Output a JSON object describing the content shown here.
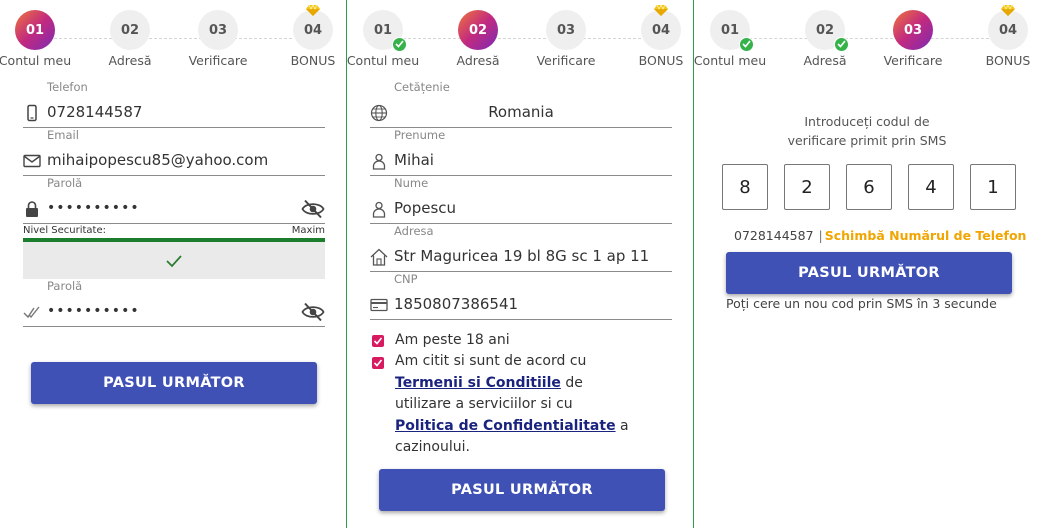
{
  "steps": [
    {
      "num": "01",
      "label": "Contul meu"
    },
    {
      "num": "02",
      "label": "Adresă"
    },
    {
      "num": "03",
      "label": "Verificare"
    },
    {
      "num": "04",
      "label": "BONUS"
    }
  ],
  "colors": {
    "accent": "#3f51b5",
    "success": "#36b24a",
    "checkbox": "#d81b60",
    "link": "#1a237e",
    "highlight": "#f0a500",
    "divider": "#2e9a4a"
  },
  "account": {
    "phone_label": "Telefon",
    "phone_value": "0728144587",
    "email_label": "Email",
    "email_value": "mihaipopescu85@yahoo.com",
    "password_label": "Parolă",
    "password_value": "••••••••••",
    "security_label": "Nivel Securitate:",
    "security_level": "Maxim",
    "security_fraction": 1.0,
    "confirm_label": "Parolă",
    "confirm_value": "••••••••••",
    "next_button": "PASUL URMĂTOR"
  },
  "address": {
    "citizenship_label": "Cetățenie",
    "citizenship_value": "Romania",
    "firstname_label": "Prenume",
    "firstname_value": "Mihai",
    "lastname_label": "Nume",
    "lastname_value": "Popescu",
    "address_label": "Adresa",
    "address_value": "Str Maguricea 19 bl 8G sc 1 ap 11",
    "cnp_label": "CNP",
    "cnp_value": "1850807386541",
    "age_check": "Am peste 18 ani",
    "terms_pre": "Am citit si sunt de acord cu",
    "terms_link": "Termenii si Conditiile",
    "terms_mid": "de utilizare a serviciilor si cu",
    "privacy_link": "Politica de Confidentialitate",
    "terms_post": "a cazinoului.",
    "next_button": "PASUL URMĂTOR"
  },
  "verify": {
    "title_line1": "Introduceți codul de",
    "title_line2": "verificare primit prin SMS",
    "code": [
      "8",
      "2",
      "6",
      "4",
      "1"
    ],
    "phone": "0728144587",
    "separator": "|",
    "change_link": "Schimbă Numărul de Telefon",
    "next_button": "PASUL URMĂTOR",
    "resend_text": "Poți cere un nou cod prin SMS în 3 secunde"
  }
}
